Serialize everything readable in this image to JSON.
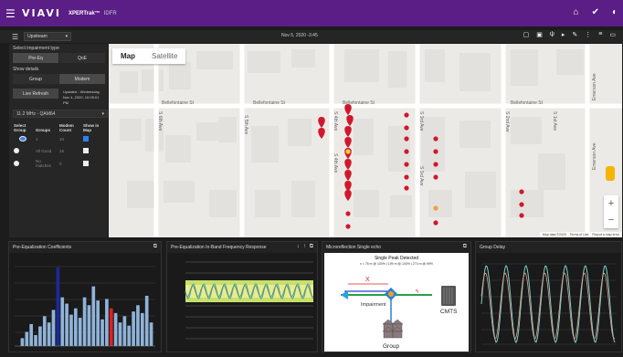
{
  "header": {
    "brand": "VIAVI",
    "product": "XPERTrak™",
    "section": "IDFR",
    "icons": [
      "home-icon",
      "check-icon",
      "contrast-icon"
    ]
  },
  "toolbar": {
    "direction": "Upstream",
    "datetime": "Nov 5, 2020 -3:45",
    "icons": [
      "screen-icon",
      "image-icon",
      "antenna-icon",
      "play-icon",
      "edit-icon",
      "more-vert-icon",
      "list-icon",
      "panel-icon"
    ]
  },
  "left_panel": {
    "select_impairment_label": "Select impairment type",
    "tabs": [
      "Pre-Eq",
      "QoE"
    ],
    "show_details_label": "Show details",
    "details_tabs": [
      "Group",
      "Modem"
    ],
    "refresh_label": "Live Refresh",
    "updated_text": "Updated - Wednesday, Nov 4, 2020, 10:05:01 PM",
    "frequency": "11.2 MHz - QAM64",
    "table": {
      "headers": [
        "Select Group",
        "Groups",
        "Modem Count",
        "Show in Map"
      ],
      "rows": [
        {
          "group": "1",
          "count": "10",
          "selected": true,
          "show": true
        },
        {
          "group": "All Good",
          "count": "16",
          "selected": false,
          "show": false
        },
        {
          "group": "No matches",
          "count": "0",
          "selected": false,
          "show": false
        }
      ]
    }
  },
  "map": {
    "tabs": [
      "Map",
      "Satellite"
    ],
    "streets": [
      "Bellefontaine St",
      "Bellefontaine St",
      "Bellefontaine St",
      "Bellefontaine St",
      "S 6th Ave",
      "S 5th Ave",
      "S 4th Ave",
      "S 4th Ave",
      "S 3rd Ave",
      "S 3rd Ave",
      "S 2nd Ave",
      "S 1st Ave",
      "Emerson Ave",
      "Emerson Ave"
    ],
    "attribution": [
      "Map data ©2020",
      "Terms of Use",
      "Report a map error"
    ]
  },
  "panels": [
    {
      "title": "Pre-Equalization Coefficients"
    },
    {
      "title": "Pre-Equalization In-Band Frequency Response"
    },
    {
      "title": "Microreflection Single echo"
    },
    {
      "title": "Group Delay"
    }
  ],
  "echo": {
    "headline": "Single Peak Detected",
    "detail": "x = 75 m @ 100% | 199 m @ 100% | 274 m @ 99%",
    "x_label": "X",
    "impairment_label": "Impairment",
    "cmts_label": "CMTS",
    "group_label": "Group"
  },
  "charts": {
    "coefficients": {
      "values": [
        0.1,
        0.18,
        0.28,
        0.14,
        0.25,
        0.38,
        0.3,
        0.46,
        1.0,
        0.62,
        0.54,
        0.4,
        0.48,
        0.36,
        0.62,
        0.52,
        0.76,
        0.58,
        0.34,
        0.6,
        0.48,
        0.42,
        0.3,
        0.38,
        0.26,
        0.44,
        0.52,
        0.42,
        0.64,
        0.3
      ],
      "highlight_main": 8,
      "highlight_red": 20
    }
  },
  "colors": {
    "header": "#5a1e86",
    "marker": "#d0182c",
    "bar": "#8fb3d9",
    "highlight_main": "#1a2a9c",
    "highlight_red": "#e02020"
  }
}
